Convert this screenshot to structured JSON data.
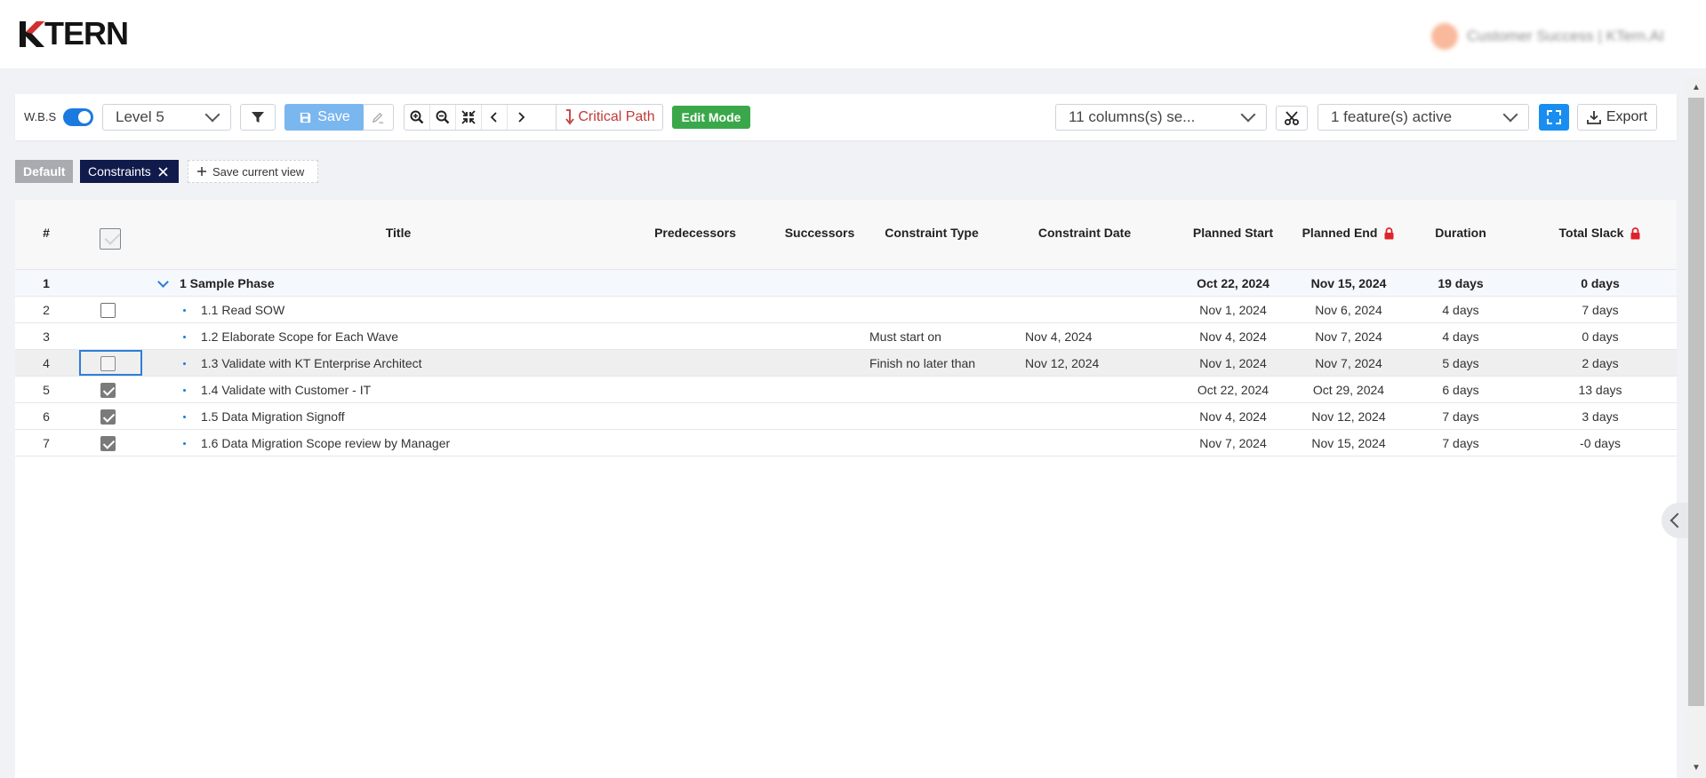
{
  "app": {
    "logo": "KTERN",
    "user_name": "Customer Success | KTern.AI"
  },
  "toolbar": {
    "wbs_label": "W.B.S",
    "level_select": "Level 5",
    "save_label": "Save",
    "critical_path_label": "Critical Path",
    "edit_mode_label": "Edit Mode",
    "columns_select": "11 columns(s) se...",
    "features_select": "1 feature(s) active",
    "export_label": "Export"
  },
  "views": {
    "default": "Default",
    "active": "Constraints",
    "save_current": "Save current view"
  },
  "grid": {
    "columns": [
      "#",
      "Title",
      "Predecessors",
      "Successors",
      "Constraint Type",
      "Constraint Date",
      "Planned Start",
      "Planned End",
      "Duration",
      "Total Slack"
    ],
    "rows": [
      {
        "num": "1",
        "title": "1 Sample Phase",
        "constraint_type": "",
        "constraint_date": "",
        "planned_start": "Oct 22, 2024",
        "planned_end": "Nov 15, 2024",
        "duration": "19 days",
        "total_slack": "0 days"
      },
      {
        "num": "2",
        "title": "1.1 Read SOW",
        "constraint_type": "",
        "constraint_date": "",
        "planned_start": "Nov 1, 2024",
        "planned_end": "Nov 6, 2024",
        "duration": "4 days",
        "total_slack": "7 days"
      },
      {
        "num": "3",
        "title": "1.2 Elaborate Scope for Each Wave",
        "constraint_type": "Must start on",
        "constraint_date": "Nov 4, 2024",
        "planned_start": "Nov 4, 2024",
        "planned_end": "Nov 7, 2024",
        "duration": "4 days",
        "total_slack": "0 days"
      },
      {
        "num": "4",
        "title": "1.3 Validate with KT Enterprise Architect",
        "constraint_type": "Finish no later than",
        "constraint_date": "Nov 12, 2024",
        "planned_start": "Nov 1, 2024",
        "planned_end": "Nov 7, 2024",
        "duration": "5 days",
        "total_slack": "2 days"
      },
      {
        "num": "5",
        "title": "1.4 Validate with Customer - IT",
        "constraint_type": "",
        "constraint_date": "",
        "planned_start": "Oct 22, 2024",
        "planned_end": "Oct 29, 2024",
        "duration": "6 days",
        "total_slack": "13 days"
      },
      {
        "num": "6",
        "title": "1.5 Data Migration Signoff",
        "constraint_type": "",
        "constraint_date": "",
        "planned_start": "Nov 4, 2024",
        "planned_end": "Nov 12, 2024",
        "duration": "7 days",
        "total_slack": "3 days"
      },
      {
        "num": "7",
        "title": "1.6 Data Migration Scope review by Manager",
        "constraint_type": "",
        "constraint_date": "",
        "planned_start": "Nov 7, 2024",
        "planned_end": "Nov 15, 2024",
        "duration": "7 days",
        "total_slack": "-0 days"
      }
    ]
  },
  "colors": {
    "accent": "#1b7ae0",
    "critical": "#c13a3a",
    "edit_mode": "#3aa84a",
    "active_view": "#101a4b",
    "lock": "#e0222a"
  },
  "icons": [
    "filter-icon",
    "save-icon",
    "edit-icon",
    "zoom-in-icon",
    "zoom-out-icon",
    "collapse-icon",
    "chevron-left-icon",
    "chevron-right-icon",
    "critical-path-icon",
    "scissors-icon",
    "fullscreen-icon",
    "download-icon",
    "lock-icon",
    "close-icon",
    "plus-icon"
  ]
}
